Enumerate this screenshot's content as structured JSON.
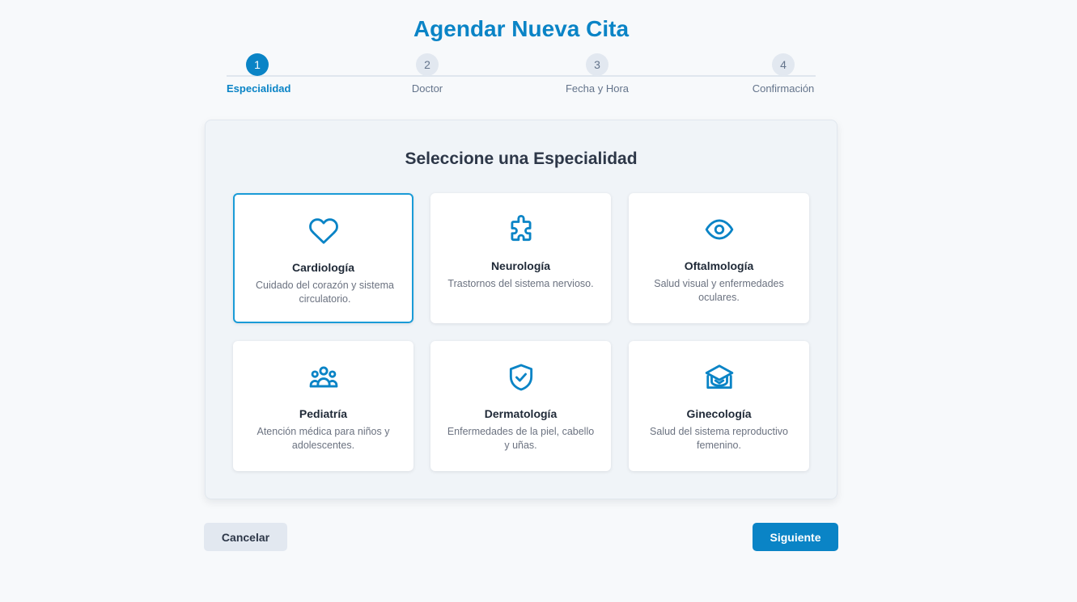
{
  "page": {
    "title": "Agendar Nueva Cita"
  },
  "stepper": {
    "steps": [
      {
        "number": "1",
        "label": "Especialidad",
        "state": "active"
      },
      {
        "number": "2",
        "label": "Doctor",
        "state": "pending"
      },
      {
        "number": "3",
        "label": "Fecha y Hora",
        "state": "pending"
      },
      {
        "number": "4",
        "label": "Confirmación",
        "state": "pending"
      }
    ]
  },
  "panel": {
    "title": "Seleccione una Especialidad",
    "specialties": [
      {
        "name": "Cardiología",
        "description": "Cuidado del corazón y sistema circulatorio.",
        "icon": "heart-icon",
        "selected": true
      },
      {
        "name": "Neurología",
        "description": "Trastornos del sistema nervioso.",
        "icon": "puzzle-icon",
        "selected": false
      },
      {
        "name": "Oftalmología",
        "description": "Salud visual y enfermedades oculares.",
        "icon": "eye-icon",
        "selected": false
      },
      {
        "name": "Pediatría",
        "description": "Atención médica para niños y adolescentes.",
        "icon": "users-icon",
        "selected": false
      },
      {
        "name": "Dermatología",
        "description": "Enfermedades de la piel, cabello y uñas.",
        "icon": "shield-check-icon",
        "selected": false
      },
      {
        "name": "Ginecología",
        "description": "Salud del sistema reproductivo femenino.",
        "icon": "academic-cap-icon",
        "selected": false
      }
    ]
  },
  "actions": {
    "cancel_label": "Cancelar",
    "next_label": "Siguiente"
  },
  "colors": {
    "accent": "#0a84c6",
    "selected_border": "#1a9bd7",
    "muted": "#64748b",
    "background": "#f7f9fb"
  }
}
